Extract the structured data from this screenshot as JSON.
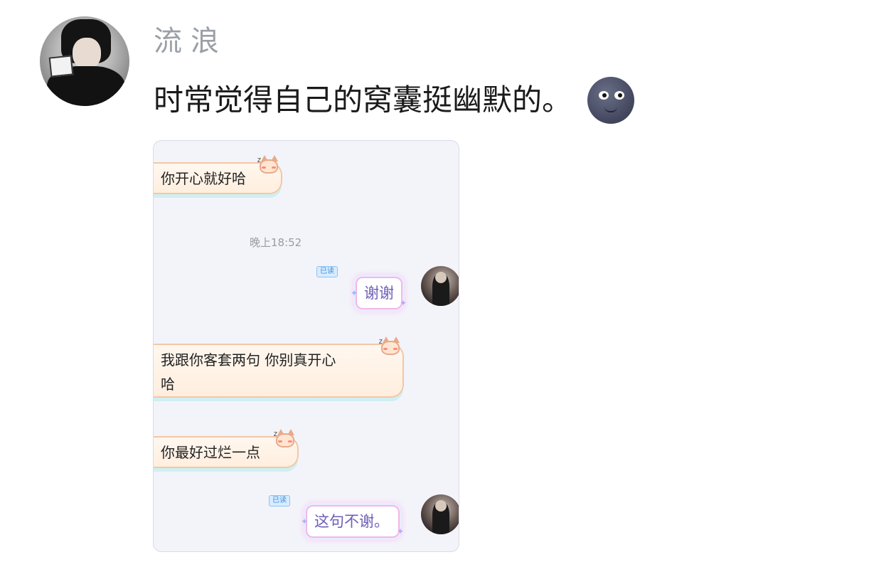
{
  "post": {
    "username": "流浪",
    "text": "时常觉得自己的窝囊挺幽默的。",
    "emoji": "new-moon-face"
  },
  "chat_screenshot": {
    "messages": [
      {
        "side": "left",
        "text": "你开心就好哈"
      },
      {
        "side": "time",
        "text": "晚上18:52"
      },
      {
        "side": "right",
        "text": "谢谢",
        "status": "已读"
      },
      {
        "side": "left",
        "text_line1": "我跟你客套两句 你别真开心",
        "text_line2": "哈"
      },
      {
        "side": "left",
        "text": "你最好过烂一点"
      },
      {
        "side": "right",
        "text": "这句不谢。",
        "status": "已读"
      }
    ]
  },
  "colors": {
    "username": "#9aa0a6",
    "text": "#1a1a1a",
    "chat_bg": "#f3f4fa",
    "out_text": "#6c5fb8",
    "read_badge": "#3a8fd9"
  }
}
